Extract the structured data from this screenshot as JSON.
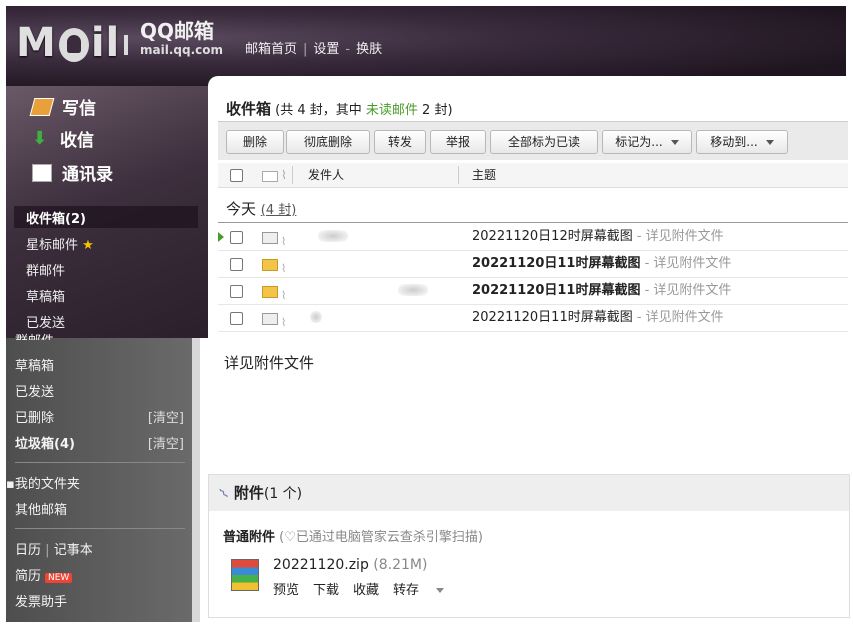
{
  "header": {
    "logo_moil_left": "M",
    "logo_moil_right": "il",
    "logo_brand": "QQ邮箱",
    "logo_domain": "mail.qq.com",
    "nav": [
      "邮箱首页",
      "设置",
      "换肤"
    ]
  },
  "sidebar": {
    "actions": [
      "写信",
      "收信",
      "通讯录"
    ],
    "folders": [
      {
        "label": "收件箱(2)",
        "selected": true
      },
      {
        "label": "星标邮件"
      },
      {
        "label": "群邮件"
      },
      {
        "label": "草稿箱"
      },
      {
        "label": "已发送"
      }
    ],
    "lower": {
      "partial_top": "群邮件",
      "items": [
        {
          "label": "草稿箱"
        },
        {
          "label": "已发送"
        },
        {
          "label": "已删除",
          "right": "[清空]"
        },
        {
          "label": "垃圾箱(4)",
          "right": "[清空]",
          "bold": true
        }
      ],
      "my_folders": "我的文件夹",
      "other_mail": "其他邮箱",
      "calendar": "日历",
      "notes": "记事本",
      "resume": "简历",
      "new_badge": "NEW",
      "invoice": "发票助手"
    }
  },
  "inbox": {
    "title": "收件箱",
    "summary_pre": "(共 4 封，其中 ",
    "unread_link": "未读邮件",
    "summary_post": " 2 封)"
  },
  "toolbar": {
    "delete": "删除",
    "delete_perm": "彻底删除",
    "forward": "转发",
    "report": "举报",
    "mark_all_read": "全部标为已读",
    "mark_as": "标记为...",
    "move_to": "移动到..."
  },
  "columns": {
    "sender": "发件人",
    "subject": "主题"
  },
  "group": {
    "label": "今天",
    "count": "(4 封)"
  },
  "messages": [
    {
      "subject": "20221120日12时屏幕截图",
      "snippet": " - 详见附件文件",
      "unread": false
    },
    {
      "subject": "20221120日11时屏幕截图",
      "snippet": " - 详见附件文件",
      "unread": true
    },
    {
      "subject": "20221120日11时屏幕截图",
      "snippet": " - 详见附件文件",
      "unread": true
    },
    {
      "subject": "20221120日11时屏幕截图",
      "snippet": " - 详见附件文件",
      "unread": false
    }
  ],
  "preview": {
    "body": "详见附件文件"
  },
  "attachment": {
    "title": "附件",
    "count": "(1 个)",
    "section": "普通附件",
    "scan_note": "(♡已通过电脑管家云查杀引擎扫描)",
    "file_name": "20221120.zip",
    "file_size": "(8.21M)",
    "actions": [
      "预览",
      "下载",
      "收藏",
      "转存"
    ]
  }
}
